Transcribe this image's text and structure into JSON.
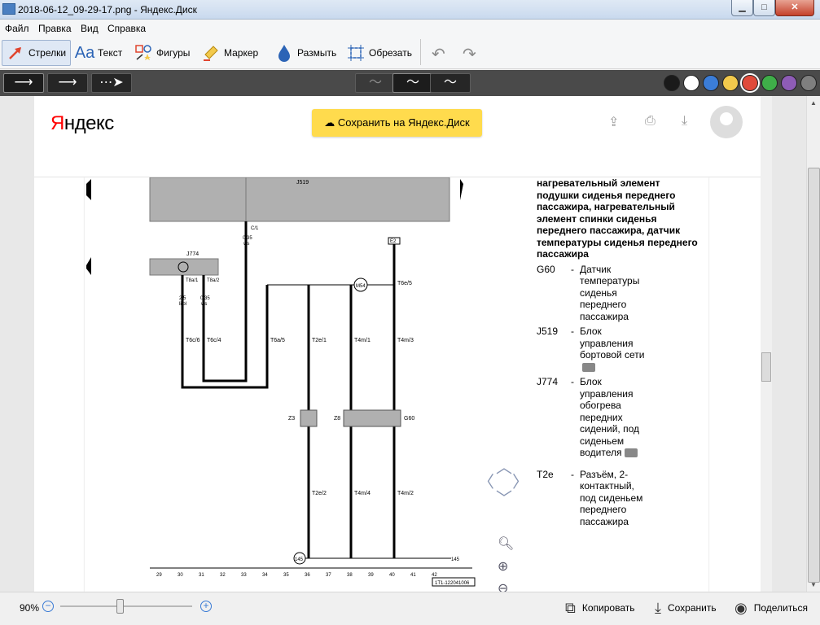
{
  "window": {
    "title": "2018-06-12_09-29-17.png - Яндекс.Диск",
    "min_glyph": "▁",
    "max_glyph": "□",
    "close_glyph": "✕"
  },
  "menu": [
    "Файл",
    "Правка",
    "Вид",
    "Справка"
  ],
  "tools": [
    {
      "label": "Стрелки",
      "icon": "arrow-icon",
      "active": true
    },
    {
      "label": "Текст",
      "icon": "text-icon"
    },
    {
      "label": "Фигуры",
      "icon": "shapes-icon"
    },
    {
      "label": "Маркер",
      "icon": "marker-icon"
    },
    {
      "label": "Размыть",
      "icon": "blur-drop-icon"
    },
    {
      "label": "Обрезать",
      "icon": "crop-icon"
    }
  ],
  "colors": [
    "#1a1a1a",
    "#ffffff",
    "#3b7dd8",
    "#f2c94c",
    "#e04a3a",
    "#3fae49",
    "#8e5cb6",
    "#7f7f7f"
  ],
  "yandex": {
    "logo_red": "Я",
    "logo_rest": "ндекс",
    "save_button": "Сохранить на Яндекс.Диск"
  },
  "schematic": {
    "labels": {
      "j519": "J519",
      "j774": "J774",
      "c1": "C/1",
      "w035a": "0,35",
      "ws": "ws",
      "t8a1": "T8a/1",
      "t8a2": "T8a/2",
      "w25a": "2,5",
      "libl": "li/bl",
      "w035b": "0,35",
      "ws2": "ws",
      "t6c6": "T6c/6",
      "t6c4": "T6c/4",
      "t6a5": "T6a/5",
      "t2e1": "T2e/1",
      "t4m1": "T4m/1",
      "t4m3": "T4m/3",
      "t6e5": "T6e/5",
      "m54": "M54",
      "e2": "E2",
      "z3": "Z3",
      "z8": "Z8",
      "g60": "G60",
      "t2e2": "T2e/2",
      "t4m4": "T4m/4",
      "t4m2": "T4m/2",
      "n145": "145",
      "code": "1T1-122041006"
    },
    "ticks": [
      "29",
      "30",
      "31",
      "32",
      "33",
      "34",
      "35",
      "36",
      "37",
      "38",
      "39",
      "40",
      "41",
      "42"
    ]
  },
  "legend": {
    "header": "нагревательный элемент подушки сиденья переднего пассажира, нагревательный элемент спинки сиденья переднего пассажира, датчик температуры сиденья переднего пассажира",
    "entries": [
      {
        "code": "G60",
        "desc": "Датчик температуры сиденья переднего пассажира",
        "camera": false
      },
      {
        "code": "J519",
        "desc": "Блок управления бортовой сети",
        "camera": true
      },
      {
        "code": "J774",
        "desc": "Блок управления обогрева передних сидений, под сиденьем водителя",
        "camera": true
      },
      {
        "code": "T2e",
        "desc": "Разъём, 2-контактный, под сиденьем переднего пассажира",
        "camera": false
      }
    ]
  },
  "statusbar": {
    "zoom": "90%",
    "zoom_fraction": 0.45,
    "copy": "Копировать",
    "save": "Сохранить",
    "share": "Поделиться"
  }
}
